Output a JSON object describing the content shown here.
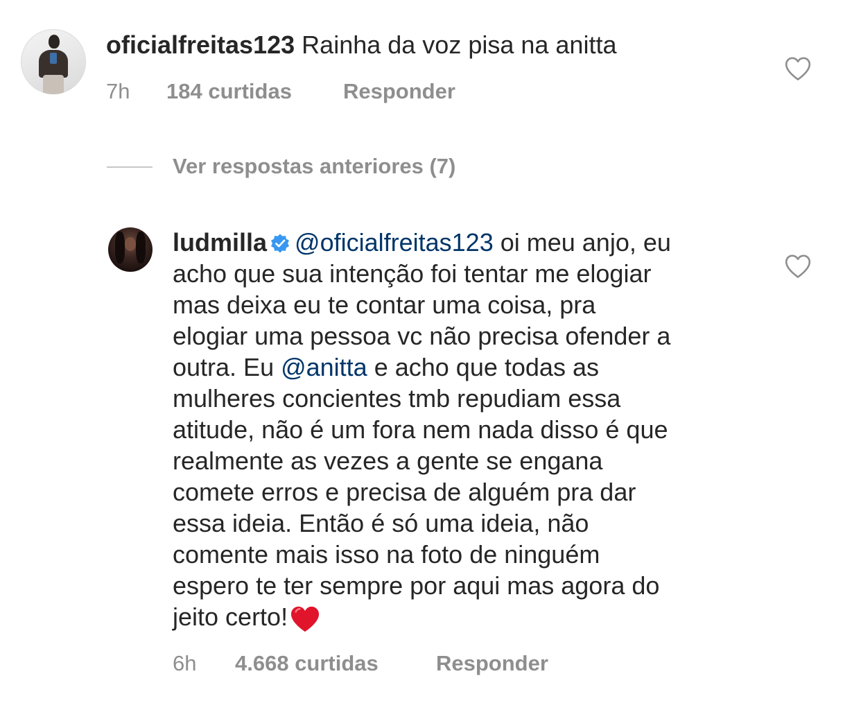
{
  "comments": [
    {
      "username": "oficialfreitas123",
      "text": "Rainha da voz pisa na anitta",
      "time": "7h",
      "likes": "184 curtidas",
      "reply_label": "Responder",
      "liked": false
    },
    {
      "username": "ludmilla",
      "verified": true,
      "mention_1": "@oficialfreitas123",
      "lines": [
        " oi meu anjo, eu",
        "acho que sua intenção foi tentar me elogiar",
        "mas deixa eu te contar uma coisa, pra",
        "elogiar uma pessoa vc não precisa ofender a",
        "outra. Eu ",
        " e acho que todas as",
        "mulheres concientes tmb repudiam essa",
        "atitude, não é um fora nem nada disso  é que",
        "realmente as vezes a gente se engana",
        "comete erros e precisa de alguém pra dar",
        "essa ideia. Então é só uma ideia, não",
        "comente mais isso na foto de ninguém",
        "espero te ter sempre por aqui mas agora do",
        "jeito certo!"
      ],
      "mention_2": "@anitta",
      "emoji": "red-heart-emoji",
      "time": "6h",
      "likes": "4.668 curtidas",
      "reply_label": "Responder",
      "liked": false
    }
  ],
  "view_previous_replies": "Ver respostas anteriores (7)",
  "colors": {
    "text": "#262626",
    "muted": "#8e8e8e",
    "mention": "#003569",
    "verified": "#3897f0",
    "heart_outline": "#8e8e8e",
    "emoji_heart": "#e0142b"
  }
}
